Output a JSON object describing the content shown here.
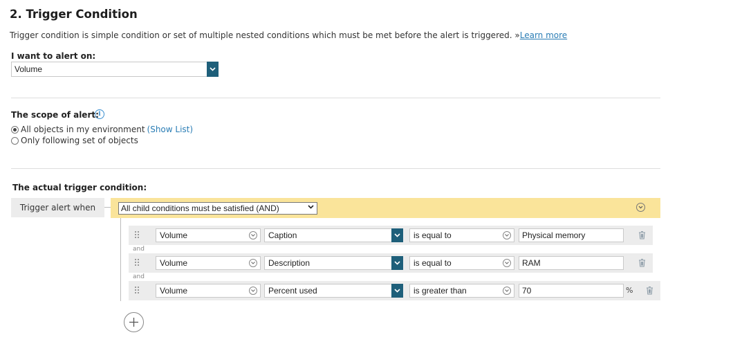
{
  "section": {
    "title": "2. Trigger Condition",
    "description": "Trigger condition is simple condition or set of multiple nested conditions which must be met before the alert is triggered.",
    "learn_more_prefix": "»",
    "learn_more": "Learn more"
  },
  "alert_on": {
    "label": "I want to alert on:",
    "value": "Volume"
  },
  "scope": {
    "label": "The scope of alert:",
    "option_all": "All objects in my environment",
    "show_list": "(Show List)",
    "option_following": "Only following set of objects",
    "selected": "all"
  },
  "trigger": {
    "heading": "The actual trigger condition:",
    "when_label": "Trigger alert when",
    "group_mode": "All child conditions must be satisfied (AND)",
    "joiner": "and",
    "conditions": [
      {
        "object": "Volume",
        "field": "Caption",
        "operator": "is equal to",
        "value": "Physical memory",
        "unit": ""
      },
      {
        "object": "Volume",
        "field": "Description",
        "operator": "is equal to",
        "value": "RAM",
        "unit": ""
      },
      {
        "object": "Volume",
        "field": "Percent used",
        "operator": "is greater than",
        "value": "70",
        "unit": "%"
      }
    ]
  },
  "colors": {
    "accent": "#1e5f7a",
    "group_bar": "#fae49a",
    "link": "#2a7db5"
  }
}
